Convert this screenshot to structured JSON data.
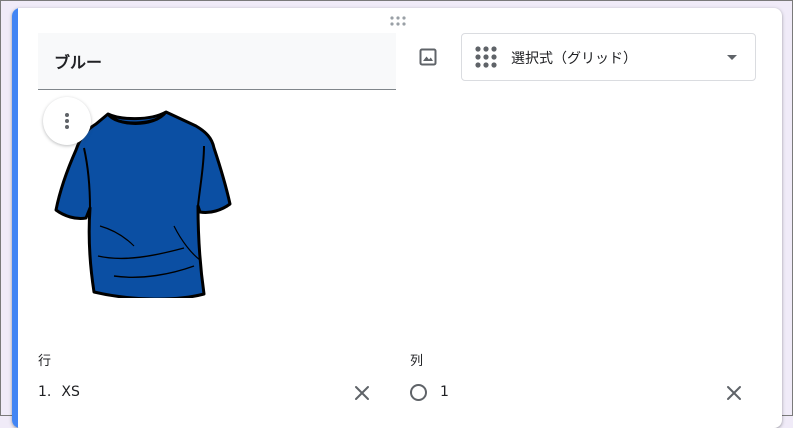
{
  "question": {
    "title": "ブルー",
    "image_button_icon": "image-icon",
    "more_button_icon": "more-vert-icon",
    "drag_handle_icon": "drag-handle-icon"
  },
  "type_select": {
    "selected": "選択式（グリッド）",
    "icon": "grid-dots-icon",
    "caret_icon": "arrow-drop-down-icon"
  },
  "image": {
    "description_icon": "blue-tshirt-image",
    "shirt_color": "#0b4fa3"
  },
  "rows": {
    "label": "行",
    "items": [
      {
        "number": "1.",
        "text": "XS"
      }
    ]
  },
  "columns": {
    "label": "列",
    "items": [
      {
        "text": "1"
      }
    ]
  },
  "colors": {
    "accent": "#4285f4",
    "background": "#f0ebf8",
    "icon": "#5f6368"
  }
}
